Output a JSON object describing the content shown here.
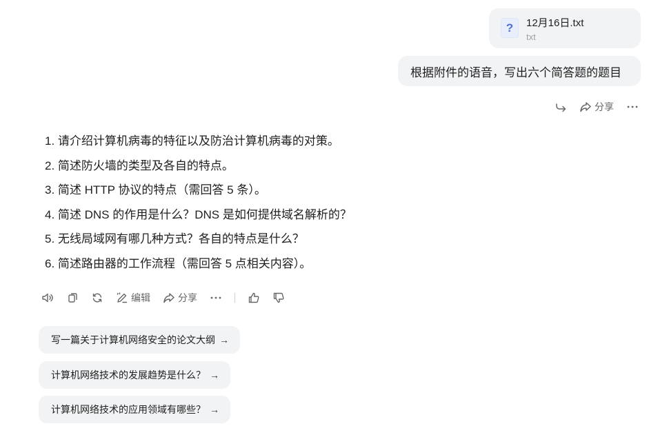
{
  "attachment": {
    "name": "12月16日.txt",
    "ext": "txt",
    "icon": "file-unknown-icon"
  },
  "user_message": "根据附件的语音，写出六个简答题的题目",
  "user_actions": {
    "share_label": "分享"
  },
  "answer": {
    "items": [
      "1. 请介绍计算机病毒的特征以及防治计算机病毒的对策。",
      "2. 简述防火墙的类型及各自的特点。",
      "3. 简述 HTTP 协议的特点（需回答 5 条）。",
      "4. 简述 DNS 的作用是什么？DNS 是如何提供域名解析的？",
      "5. 无线局域网有哪几种方式？各自的特点是什么？",
      "6. 简述路由器的工作流程（需回答 5 点相关内容）。"
    ]
  },
  "answer_actions": {
    "edit_label": "编辑",
    "share_label": "分享"
  },
  "suggestions": [
    {
      "label": "写一篇关于计算机网络安全的论文大纲",
      "arrow": "→"
    },
    {
      "label": "计算机网络技术的发展趋势是什么？",
      "arrow": "→"
    },
    {
      "label": "计算机网络技术的应用领域有哪些？",
      "arrow": "→"
    }
  ]
}
